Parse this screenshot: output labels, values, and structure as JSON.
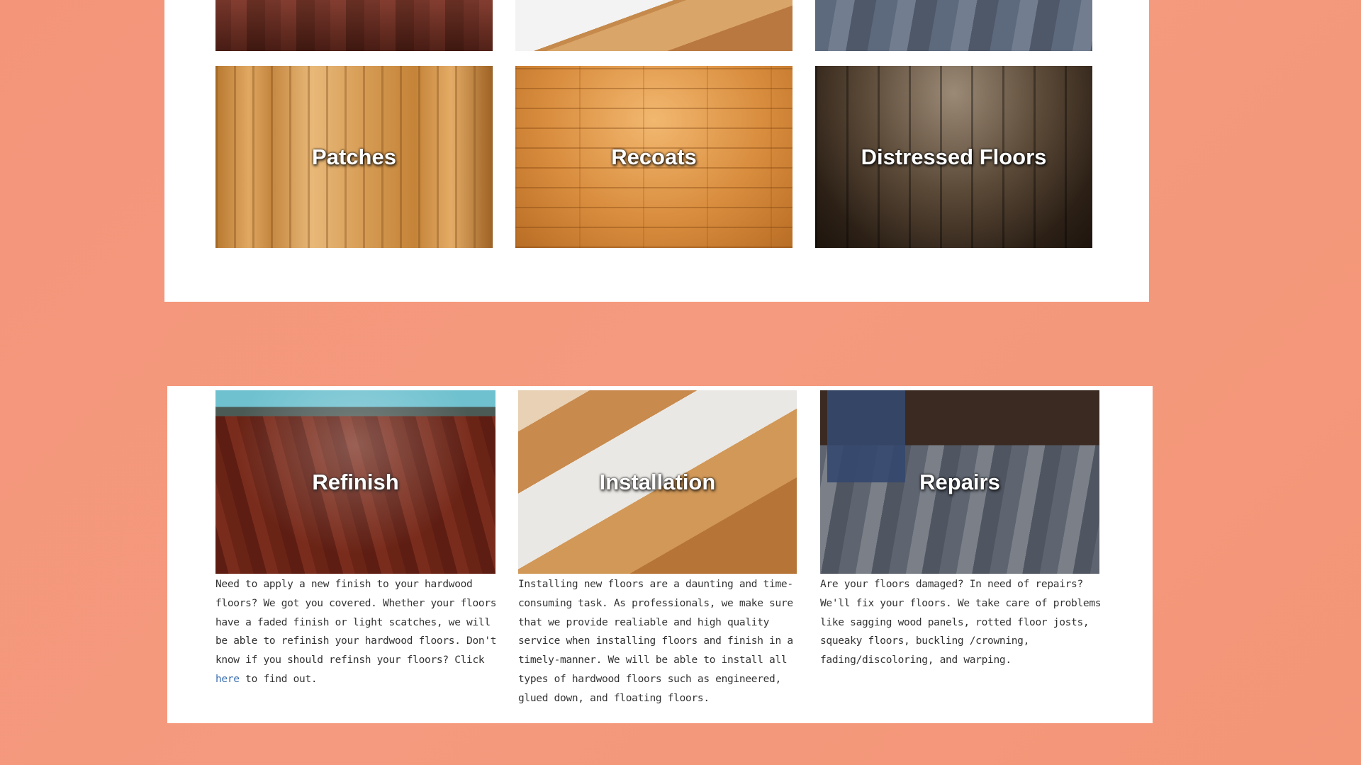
{
  "services_top": {
    "tiles": [
      {
        "label": "Patches"
      },
      {
        "label": "Recoats"
      },
      {
        "label": "Distressed Floors"
      }
    ]
  },
  "services_bottom": {
    "refinish": {
      "label": "Refinish",
      "text_before": "Need to apply a new finish to your hardwood floors? We got you covered. Whether your floors have a faded finish or light scatches, we will be able to refinish your hardwood floors. Don't know if you should refinsh your floors? Click ",
      "link_text": "here",
      "text_after": " to find out."
    },
    "installation": {
      "label": "Installation",
      "text": "Installing new floors are a daunting and time-consuming task. As professionals, we make sure that we provide realiable and high quality service when installing floors and finish in a timely-manner. We will be able to install all types of hardwood floors such as engineered, glued down, and floating floors."
    },
    "repairs": {
      "label": "Repairs",
      "text": "Are your floors damaged? In need of repairs? We'll fix your floors. We take care of problems like sagging wood panels, rotted floor josts, squeaky floors, buckling /crowning, fading/discoloring, and warping."
    }
  },
  "colors": {
    "background": "#f4957a",
    "card": "#ffffff",
    "link": "#3a6fb0",
    "body_text": "#333333"
  }
}
